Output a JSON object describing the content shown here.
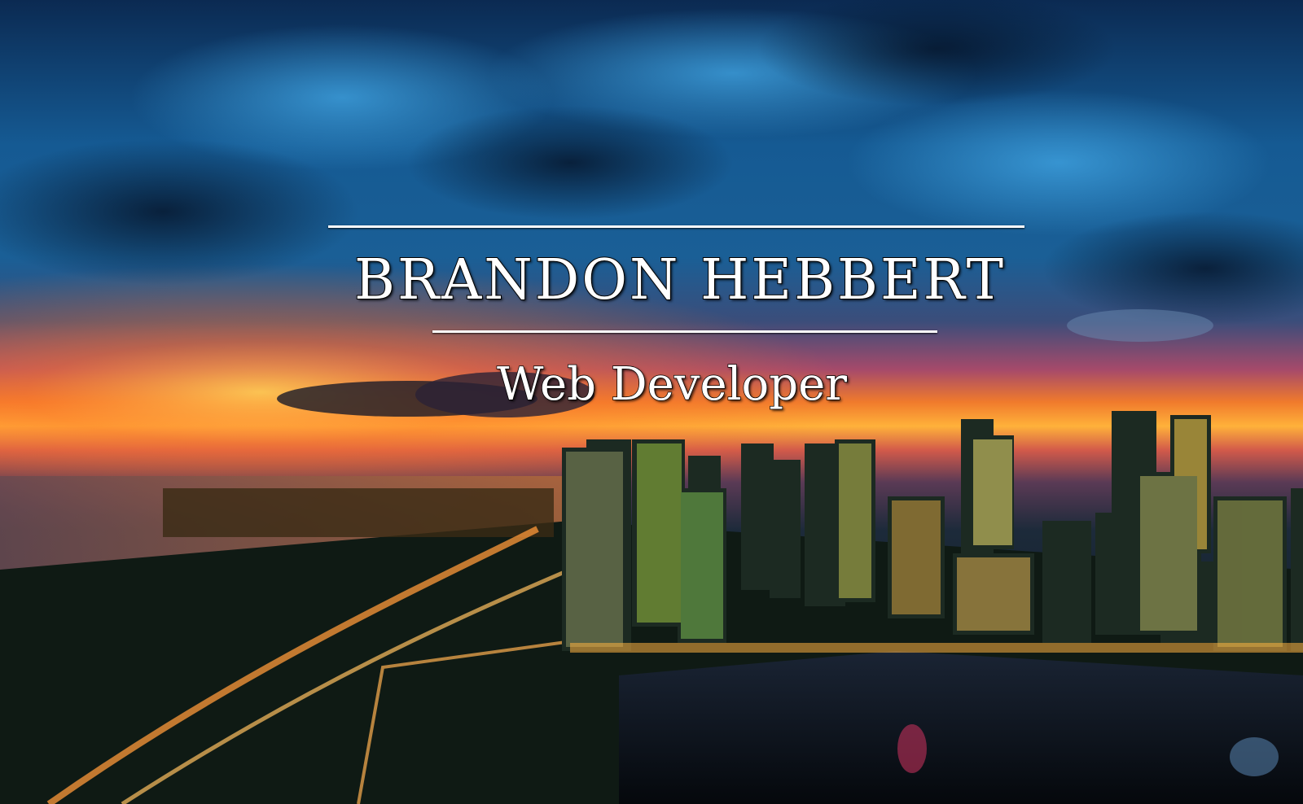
{
  "hero": {
    "name": "BRANDON HEBBERT",
    "role": "Web Developer"
  },
  "background": {
    "description_icon": "city-skyline-sunset-image",
    "colors": {
      "sky_top": "#0d3b6e",
      "sky_mid": "#1f6fae",
      "sunset_orange": "#ff8a1e",
      "sunset_pink": "#e0567a",
      "city_dark": "#0b1a1e",
      "lights": "#ffd35a"
    }
  }
}
